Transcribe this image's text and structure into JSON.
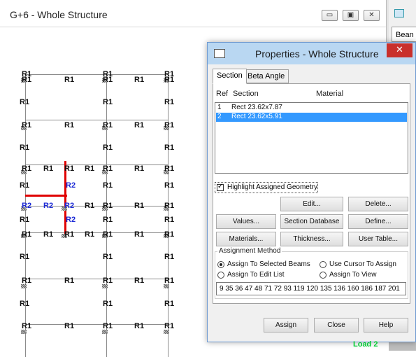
{
  "window": {
    "title": "G+6 - Whole Structure",
    "controls": {
      "minimize": "▭",
      "maximize": "▣",
      "close": "✕"
    }
  },
  "right_panel": {
    "tab_label": "Bean",
    "load_label": "Load 2"
  },
  "structure": {
    "labels_row_top": [
      "R1",
      "R1",
      "R1",
      "R1",
      "R1"
    ],
    "r1": "R1",
    "r2": "R2"
  },
  "dialog": {
    "title": "Properties - Whole Structure",
    "close_glyph": "✕",
    "tabs": [
      "Section",
      "Beta Angle"
    ],
    "columns": {
      "ref": "Ref",
      "section": "Section",
      "material": "Material"
    },
    "rows": [
      {
        "ref": "1",
        "section": "Rect 23.62x7.87",
        "selected": false
      },
      {
        "ref": "2",
        "section": "Rect 23.62x5.91",
        "selected": true
      }
    ],
    "highlight_label": "Highlight Assigned Geometry",
    "highlight_checked": true,
    "buttons": {
      "edit": "Edit...",
      "delete": "Delete...",
      "values": "Values...",
      "section_database": "Section Database",
      "define": "Define...",
      "materials": "Materials...",
      "thickness": "Thickness...",
      "user_table": "User Table..."
    },
    "assignment": {
      "title": "Assignment Method",
      "options": [
        "Assign To Selected Beams",
        "Use Cursor To Assign",
        "Assign To Edit List",
        "Assign To View"
      ],
      "selected_option": "Assign To Selected Beams",
      "edit_list": "9 35 36 47 48 71 72 93 119 120 135 136 160 186 187 201"
    },
    "footer": {
      "assign": "Assign",
      "close": "Close",
      "help": "Help"
    }
  },
  "colors": {
    "selection": "#3399ff",
    "highlight_beam": "#e00000",
    "r2_label": "#1d2bd6",
    "load_label": "#00cc33"
  }
}
